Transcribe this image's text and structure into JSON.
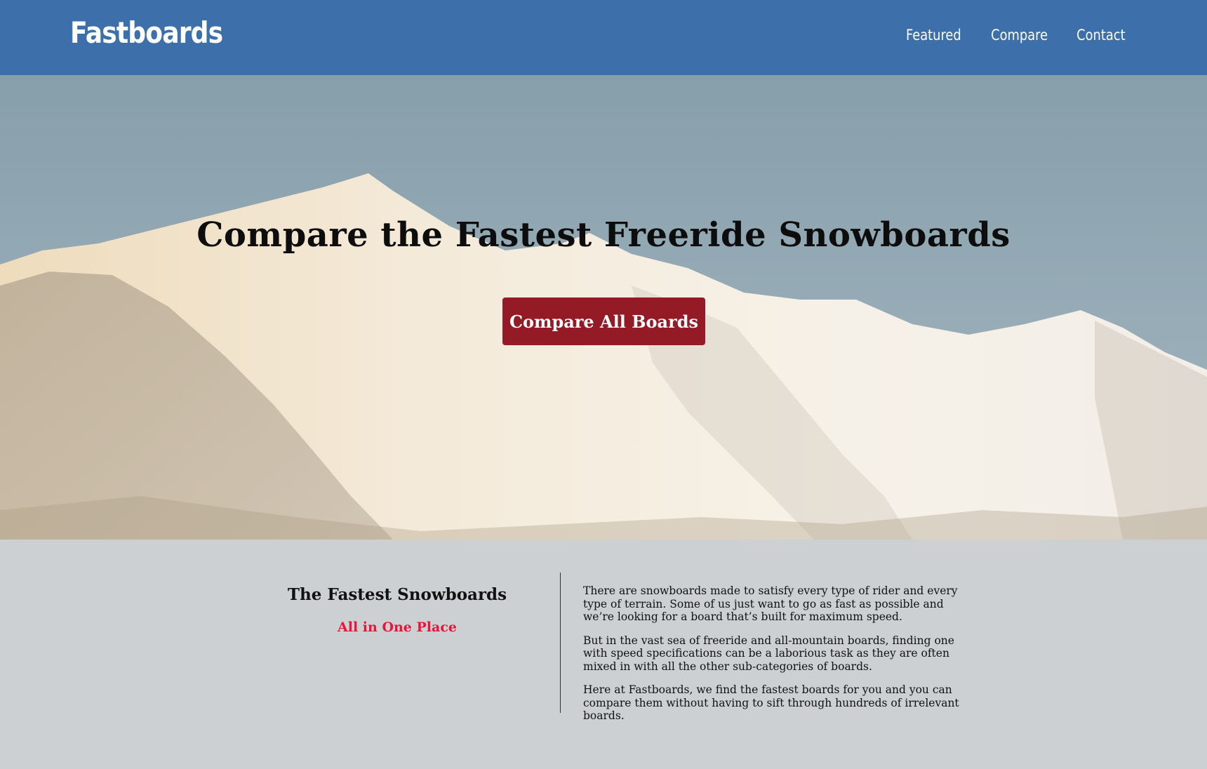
{
  "navbar": {
    "brand": "Fastboards",
    "links": [
      "Featured",
      "Compare",
      "Contact"
    ],
    "background_color": "#3d6fab"
  },
  "hero": {
    "title": "Compare the Fastest Freeride Snowboards",
    "button_label": "Compare All Boards",
    "button_color": "#941a26",
    "background_image": "snowy-mountain-ridge-photo"
  },
  "intro": {
    "heading": "The Fastest Snowboards",
    "subheading": "All in One Place",
    "subheading_color": "#e8143a",
    "paragraphs": [
      "There are snowboards made to satisfy every type of rider and every type of terrain. Some of us just want to go as fast as possible and we’re looking for a board that’s built for maximum speed.",
      "But in the vast sea of freeride and all-mountain boards, finding one with speed specifications can be a laborious task as they are often mixed in with all the other sub-categories of boards.",
      "Here at Fastboards, we find the fastest boards for you and you can compare them without having to sift through hundreds of irrelevant boards."
    ]
  }
}
